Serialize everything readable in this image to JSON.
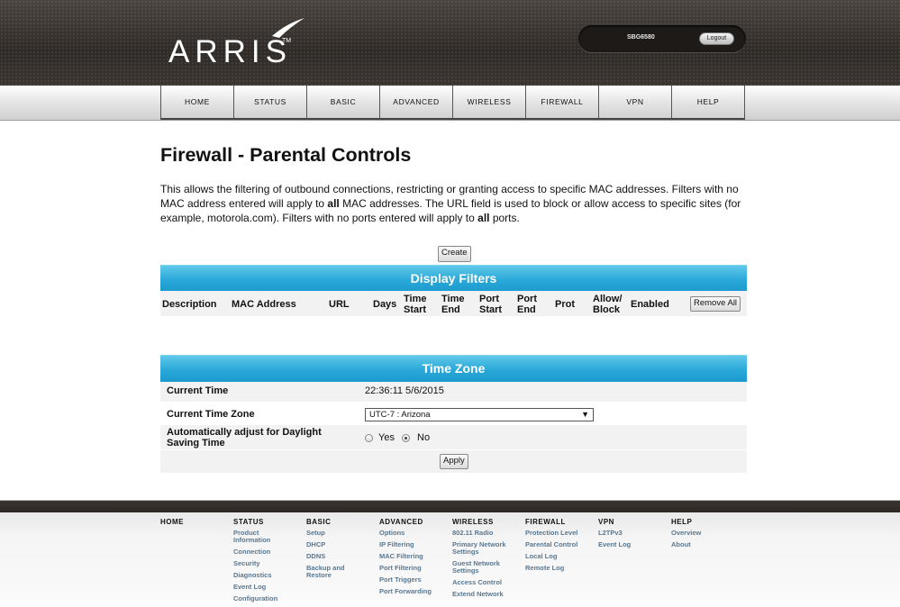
{
  "header": {
    "brand": "ARRIS",
    "trademark": "TM",
    "model": "SBG6580",
    "logout_label": "Logout"
  },
  "nav": [
    "HOME",
    "STATUS",
    "BASIC",
    "ADVANCED",
    "WIRELESS",
    "FIREWALL",
    "VPN",
    "HELP"
  ],
  "page": {
    "title": "Firewall - Parental Controls",
    "desc_1": "This allows the filtering of outbound connections, restricting or granting access to specific MAC addresses. Filters with no MAC address entered will apply to ",
    "desc_all_1": "all",
    "desc_2": " MAC addresses. The URL field is used to block or allow access to specific sites (for example, motorola.com). Filters with no ports entered will apply to ",
    "desc_all_2": "all",
    "desc_3": " ports.",
    "create_label": "Create"
  },
  "filters": {
    "title": "Display Filters",
    "columns": {
      "description": "Description",
      "mac": "MAC Address",
      "url": "URL",
      "days": "Days",
      "time_start_1": "Time",
      "time_start_2": "Start",
      "time_end_1": "Time",
      "time_end_2": "End",
      "port_start_1": "Port",
      "port_start_2": "Start",
      "port_end_1": "Port",
      "port_end_2": "End",
      "prot": "Prot",
      "allow_block_1": "Allow/",
      "allow_block_2": "Block",
      "enabled": "Enabled"
    },
    "remove_all_label": "Remove All"
  },
  "timezone": {
    "title": "Time Zone",
    "current_time_label": "Current Time",
    "current_time_value": "22:36:11 5/6/2015",
    "current_zone_label": "Current Time Zone",
    "current_zone_value": "UTC-7 : Arizona",
    "dst_label_1": "Automatically adjust for Daylight",
    "dst_label_2": "Saving Time",
    "dst_yes": "Yes",
    "dst_no": "No",
    "dst_selected": "No",
    "apply_label": "Apply"
  },
  "footer": {
    "home": {
      "head": "HOME",
      "links": []
    },
    "status": {
      "head": "STATUS",
      "links": [
        [
          "Product",
          "Information"
        ],
        [
          "Connection"
        ],
        [
          "Security"
        ],
        [
          "Diagnostics"
        ],
        [
          "Event Log"
        ],
        [
          "Configuration"
        ]
      ]
    },
    "basic": {
      "head": "BASIC",
      "links": [
        [
          "Setup"
        ],
        [
          "DHCP"
        ],
        [
          "DDNS"
        ],
        [
          "Backup and",
          "Restore"
        ]
      ]
    },
    "advanced": {
      "head": "ADVANCED",
      "links": [
        [
          "Options"
        ],
        [
          "IP Filtering"
        ],
        [
          "MAC Filtering"
        ],
        [
          "Port Filtering"
        ],
        [
          "Port Triggers"
        ],
        [
          "Port Forwarding"
        ]
      ]
    },
    "wireless": {
      "head": "WIRELESS",
      "links": [
        [
          "802.11 Radio"
        ],
        [
          "Primary Network",
          "Settings"
        ],
        [
          "Guest Network",
          "Settings"
        ],
        [
          "Access Control"
        ],
        [
          "Extend Network"
        ]
      ]
    },
    "firewall": {
      "head": "FIREWALL",
      "links": [
        [
          "Protection Level"
        ],
        [
          "Parental Control"
        ],
        [
          "Local Log"
        ],
        [
          "Remote Log"
        ]
      ]
    },
    "vpn": {
      "head": "VPN",
      "links": [
        [
          "L2TPv3"
        ],
        [
          "Event Log"
        ]
      ]
    },
    "help": {
      "head": "HELP",
      "links": [
        [
          "Overview"
        ],
        [
          "About"
        ]
      ]
    }
  },
  "colors": {
    "section_bar": "#2aa8d8",
    "footer_link": "#5a7890",
    "header_bg": "#3a3531"
  }
}
